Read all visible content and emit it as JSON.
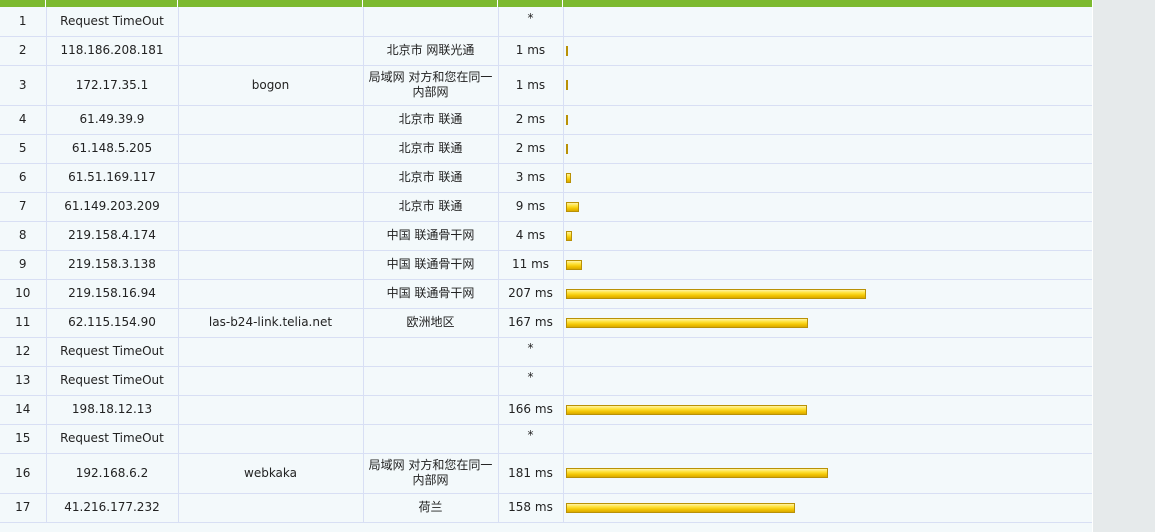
{
  "trace": {
    "rows": [
      {
        "hop": "1",
        "ip": "Request TimeOut",
        "hostname": "",
        "location": "",
        "time": "*",
        "time_ms": null
      },
      {
        "hop": "2",
        "ip": "118.186.208.181",
        "hostname": "",
        "location": "北京市 网联光通",
        "time": "1 ms",
        "time_ms": 1
      },
      {
        "hop": "3",
        "ip": "172.17.35.1",
        "hostname": "bogon",
        "location": "局域网 对方和您在同一内部网",
        "time": "1 ms",
        "time_ms": 1
      },
      {
        "hop": "4",
        "ip": "61.49.39.9",
        "hostname": "",
        "location": "北京市 联通",
        "time": "2 ms",
        "time_ms": 2
      },
      {
        "hop": "5",
        "ip": "61.148.5.205",
        "hostname": "",
        "location": "北京市 联通",
        "time": "2 ms",
        "time_ms": 2
      },
      {
        "hop": "6",
        "ip": "61.51.169.117",
        "hostname": "",
        "location": "北京市 联通",
        "time": "3 ms",
        "time_ms": 3
      },
      {
        "hop": "7",
        "ip": "61.149.203.209",
        "hostname": "",
        "location": "北京市 联通",
        "time": "9 ms",
        "time_ms": 9
      },
      {
        "hop": "8",
        "ip": "219.158.4.174",
        "hostname": "",
        "location": "中国 联通骨干网",
        "time": "4 ms",
        "time_ms": 4
      },
      {
        "hop": "9",
        "ip": "219.158.3.138",
        "hostname": "",
        "location": "中国 联通骨干网",
        "time": "11 ms",
        "time_ms": 11
      },
      {
        "hop": "10",
        "ip": "219.158.16.94",
        "hostname": "",
        "location": "中国 联通骨干网",
        "time": "207 ms",
        "time_ms": 207
      },
      {
        "hop": "11",
        "ip": "62.115.154.90",
        "hostname": "las-b24-link.telia.net",
        "location": "欧洲地区",
        "time": "167 ms",
        "time_ms": 167
      },
      {
        "hop": "12",
        "ip": "Request TimeOut",
        "hostname": "",
        "location": "",
        "time": "*",
        "time_ms": null
      },
      {
        "hop": "13",
        "ip": "Request TimeOut",
        "hostname": "",
        "location": "",
        "time": "*",
        "time_ms": null
      },
      {
        "hop": "14",
        "ip": "198.18.12.13",
        "hostname": "",
        "location": "",
        "time": "166 ms",
        "time_ms": 166
      },
      {
        "hop": "15",
        "ip": "Request TimeOut",
        "hostname": "",
        "location": "",
        "time": "*",
        "time_ms": null
      },
      {
        "hop": "16",
        "ip": "192.168.6.2",
        "hostname": "webkaka",
        "location": "局域网 对方和您在同一内部网",
        "time": "181 ms",
        "time_ms": 181
      },
      {
        "hop": "17",
        "ip": "41.216.177.232",
        "hostname": "",
        "location": "荷兰",
        "time": "158 ms",
        "time_ms": 158
      }
    ]
  },
  "colors": {
    "header_green": "#7cba2f",
    "row_background": "#f3f9fb",
    "grid_line": "#d8dff4",
    "bar_fill": "#ffe23a",
    "bar_border": "#b99106",
    "side_strip": "#e6eaeb"
  }
}
